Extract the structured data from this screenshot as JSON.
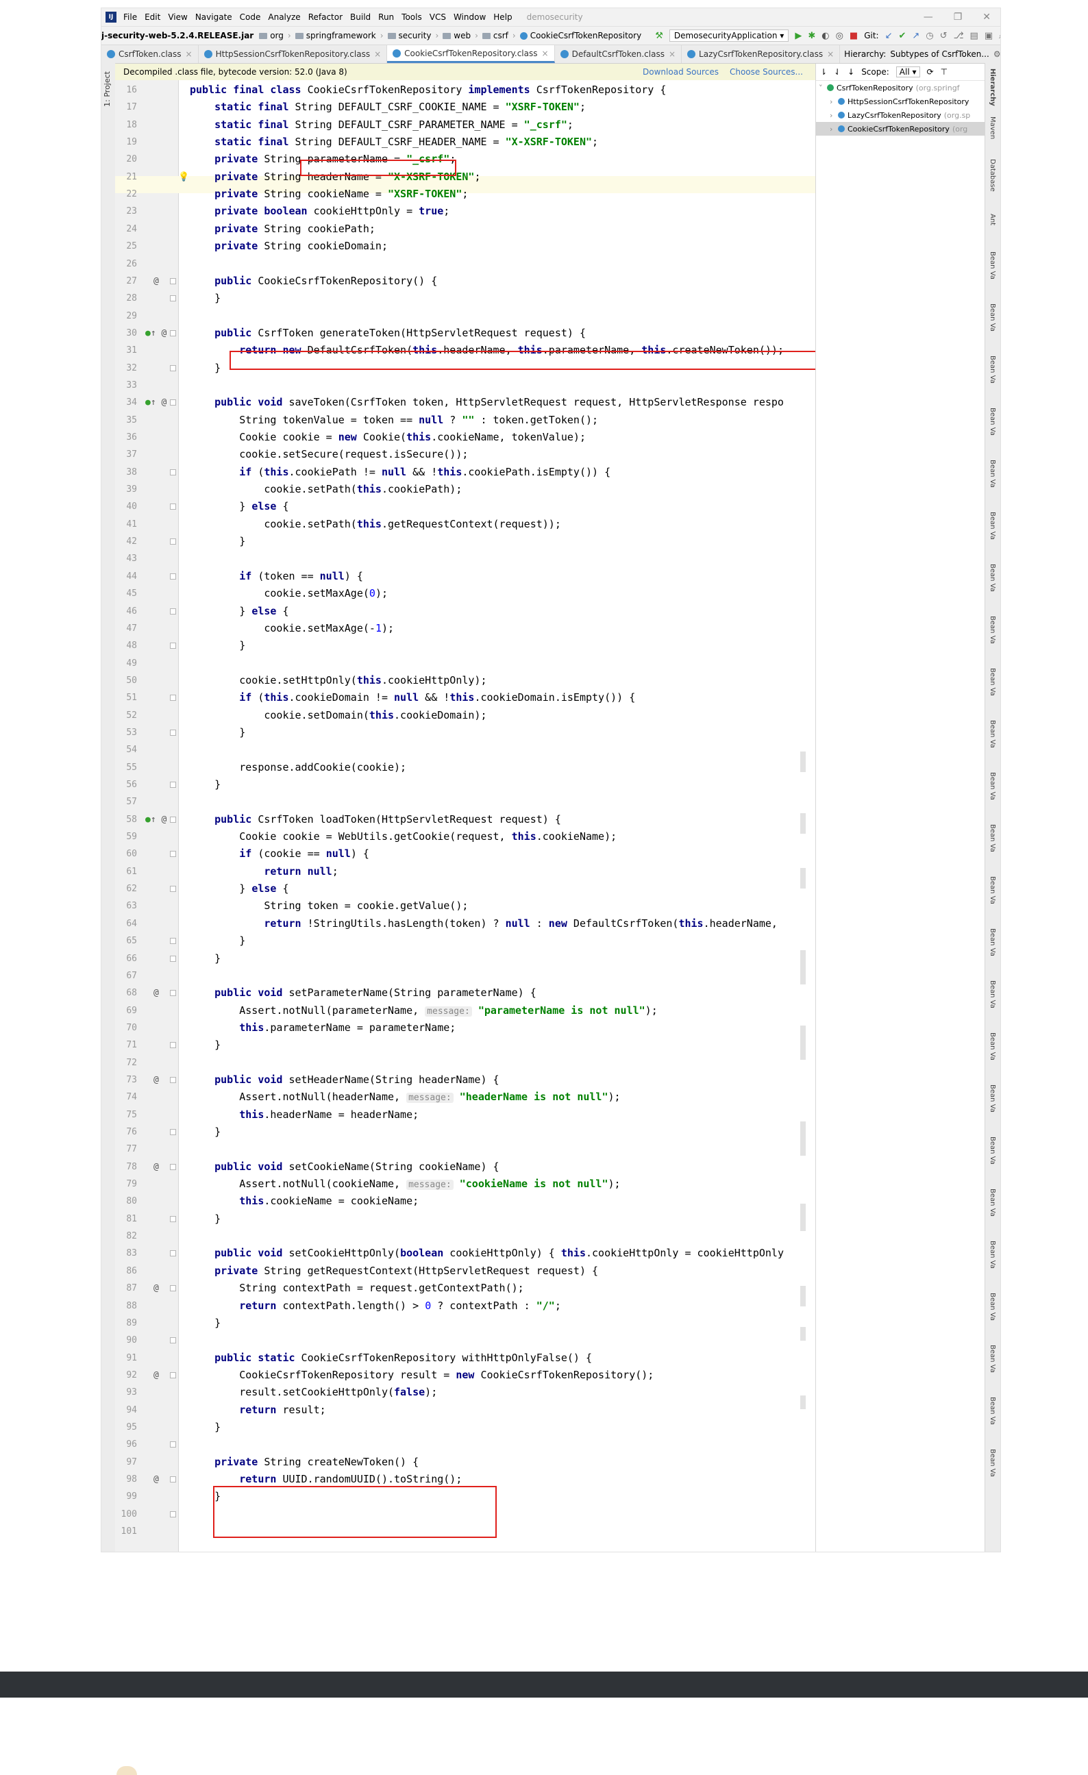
{
  "menubar": {
    "logo": "IJ",
    "items": [
      "File",
      "Edit",
      "View",
      "Navigate",
      "Code",
      "Analyze",
      "Refactor",
      "Build",
      "Run",
      "Tools",
      "VCS",
      "Window",
      "Help"
    ],
    "project": "demosecurity"
  },
  "navbar": {
    "jar": "j-security-web-5.2.4.RELEASE.jar",
    "crumbs": [
      "org",
      "springframework",
      "security",
      "web",
      "csrf"
    ],
    "current": "CookieCsrfTokenRepository",
    "run_config": "DemosecurityApplication",
    "git_label": "Git:"
  },
  "tabs": [
    {
      "label": "CsrfToken.class"
    },
    {
      "label": "HttpSessionCsrfTokenRepository.class"
    },
    {
      "label": "CookieCsrfTokenRepository.class"
    },
    {
      "label": "DefaultCsrfToken.class"
    },
    {
      "label": "LazyCsrfTokenRepository.class"
    }
  ],
  "hierarchy": {
    "title": "Hierarchy:",
    "subtitle": "Subtypes of CsrfToken...",
    "scope_label": "Scope:",
    "scope_value": "All",
    "nodes": [
      {
        "name": "CsrfTokenRepository",
        "pkg": "(org.springf"
      },
      {
        "name": "HttpSessionCsrfTokenRepository",
        "pkg": ""
      },
      {
        "name": "LazyCsrfTokenRepository",
        "pkg": "(org.sp"
      },
      {
        "name": "CookieCsrfTokenRepository",
        "pkg": "(org"
      }
    ]
  },
  "left_strip": {
    "project": "1: Project"
  },
  "right_strip": {
    "hierarchy": "Hierarchy",
    "maven": "Maven",
    "database": "Database",
    "ant": "Ant",
    "bean": "Bean Va"
  },
  "notice": {
    "text": "Decompiled .class file, bytecode version: 52.0 (Java 8)",
    "download": "Download Sources",
    "choose": "Choose Sources..."
  },
  "code": {
    "first_line": 16,
    "last_line": 101
  }
}
